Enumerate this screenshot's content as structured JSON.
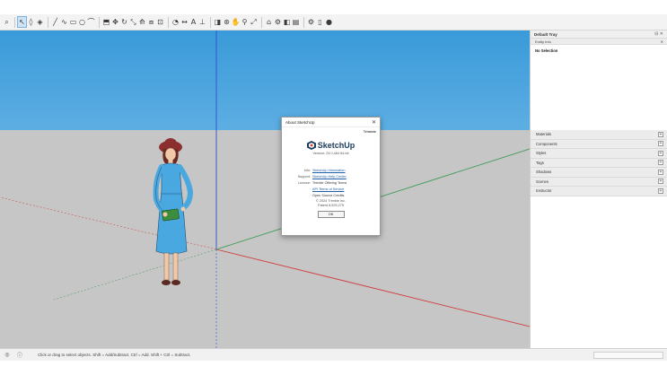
{
  "toolbar": {
    "buttons": [
      {
        "icon": "search-icon",
        "glyph": "⌕"
      },
      {
        "icon": "select-icon",
        "glyph": "↖"
      },
      {
        "icon": "eraser-icon",
        "glyph": "◊"
      },
      {
        "icon": "paint-bucket-icon",
        "glyph": "◈"
      },
      {
        "icon": "line-icon",
        "glyph": "╱"
      },
      {
        "icon": "freehand-icon",
        "glyph": "∿"
      },
      {
        "icon": "rectangle-icon",
        "glyph": "▭"
      },
      {
        "icon": "circle-icon",
        "glyph": "○"
      },
      {
        "icon": "arc-icon",
        "glyph": "⌒"
      },
      {
        "icon": "push-pull-icon",
        "glyph": "⬒"
      },
      {
        "icon": "move-icon",
        "glyph": "✥"
      },
      {
        "icon": "rotate-icon",
        "glyph": "↻"
      },
      {
        "icon": "scale-icon",
        "glyph": "⤡"
      },
      {
        "icon": "follow-me-icon",
        "glyph": "⟰"
      },
      {
        "icon": "offset-icon",
        "glyph": "⧈"
      },
      {
        "icon": "tape-measure-icon",
        "glyph": "⊡"
      },
      {
        "icon": "protractor-icon",
        "glyph": "◔"
      },
      {
        "icon": "dimension-icon",
        "glyph": "↔"
      },
      {
        "icon": "text-icon",
        "glyph": "A"
      },
      {
        "icon": "axes-icon",
        "glyph": "⊥"
      },
      {
        "icon": "section-plane-icon",
        "glyph": "◨"
      },
      {
        "icon": "orbit-icon",
        "glyph": "⊛"
      },
      {
        "icon": "pan-icon",
        "glyph": "✋"
      },
      {
        "icon": "zoom-icon",
        "glyph": "⚲"
      },
      {
        "icon": "zoom-extents-icon",
        "glyph": "⤢"
      },
      {
        "icon": "warehouse-icon",
        "glyph": "⌂"
      },
      {
        "icon": "extension-icon",
        "glyph": "⚙"
      },
      {
        "icon": "style-icon",
        "glyph": "◧"
      },
      {
        "icon": "scenes-icon",
        "glyph": "▤"
      },
      {
        "icon": "settings-icon",
        "glyph": "⚙"
      },
      {
        "icon": "document-icon",
        "glyph": "▯"
      },
      {
        "icon": "user-icon",
        "glyph": "●"
      }
    ]
  },
  "dialog": {
    "title": "About SketchUp",
    "close": "✕",
    "brand": "Trimble",
    "app_name": "SketchUp",
    "version": "Version: 24.0.484 64-bit",
    "rows": [
      {
        "key": "Info:",
        "value": "SketchUp Information",
        "link": true
      },
      {
        "key": "Support:",
        "value": "SketchUp Help Center",
        "link": true
      },
      {
        "key": "License:",
        "value": "Trimble Offering Terms",
        "link": false
      },
      {
        "key": "",
        "value": "API Terms of Service",
        "link": true
      },
      {
        "key": "",
        "value": "Open Source Credits",
        "link": false
      }
    ],
    "copyright": "© 2024 Trimble Inc.",
    "patent": "Patent 8,525,275",
    "ok_label": "OK"
  },
  "tray": {
    "title": "Default Tray",
    "controls": "⊟ ✕",
    "entity_info_label": "Entity Info",
    "entity_info_controls": "✕",
    "no_selection": "No Selection",
    "panels": [
      {
        "label": "Materials"
      },
      {
        "label": "Components"
      },
      {
        "label": "Styles"
      },
      {
        "label": "Tags"
      },
      {
        "label": "Shadows"
      },
      {
        "label": "Scenes"
      },
      {
        "label": "Instructor"
      }
    ]
  },
  "status": {
    "text": "Click or drag to select objects. Shift = Add/Subtract. Ctrl = Add. Shift + Ctrl = Subtract."
  },
  "colors": {
    "sky_top": "#3a9ad9",
    "ground": "#c6c6c6",
    "axis_red": "#d23b3b",
    "axis_green": "#3f9a55",
    "axis_blue": "#2f4fd0",
    "dress": "#4aa8e0",
    "hat": "#8b2e2e"
  }
}
